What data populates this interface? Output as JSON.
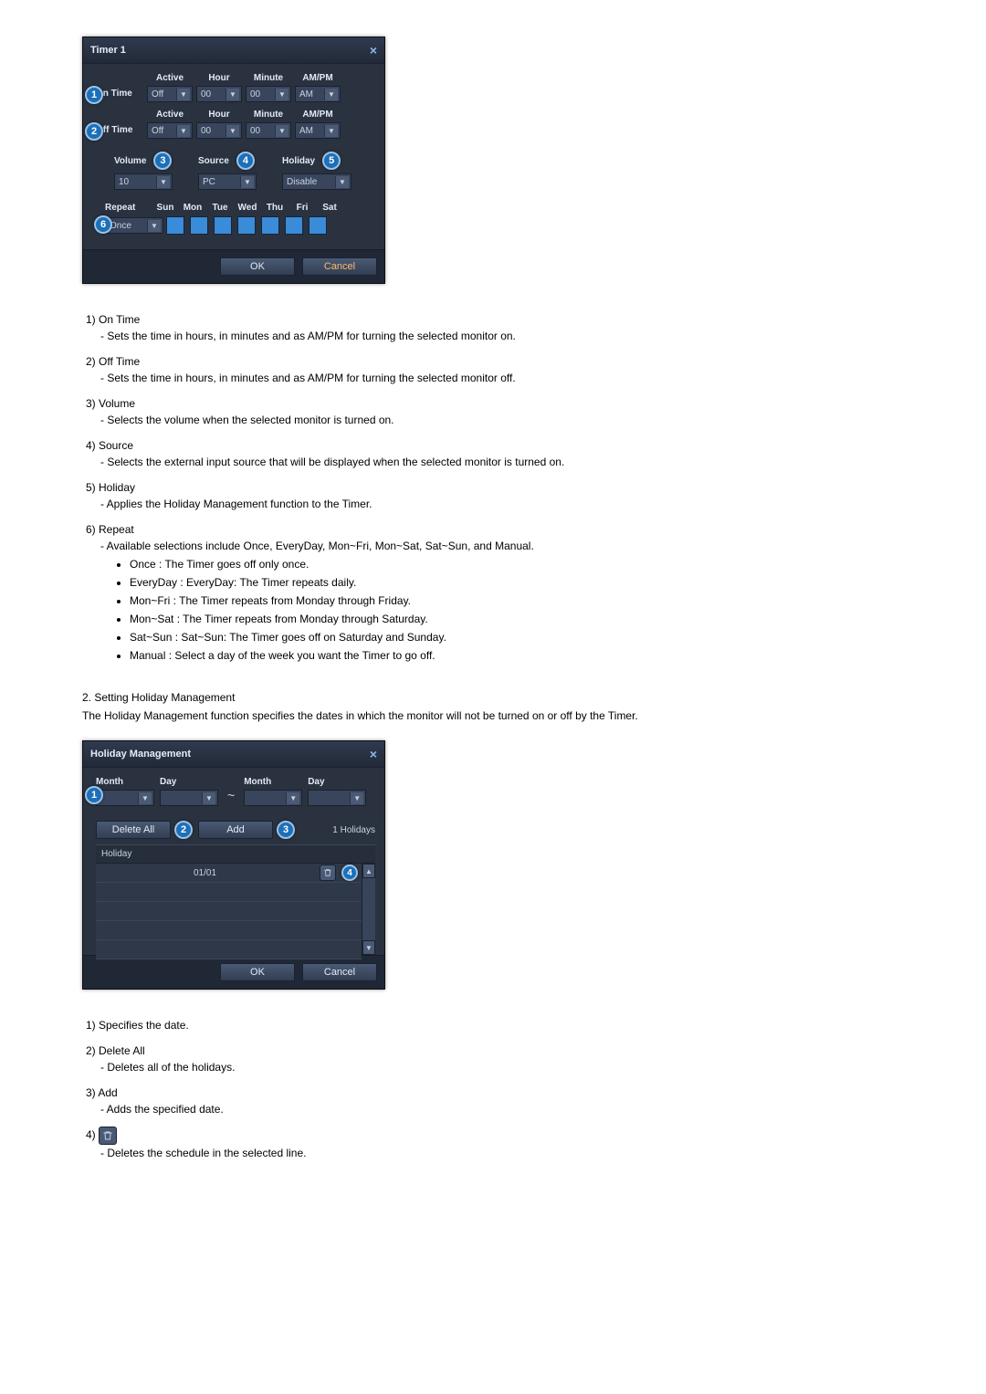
{
  "timer_dialog": {
    "title": "Timer 1",
    "callouts": {
      "c1": "1",
      "c2": "2",
      "c3": "3",
      "c4": "4",
      "c5": "5",
      "c6": "6"
    },
    "on_row": {
      "label": "On Time",
      "active_hdr": "Active",
      "active_val": "Off",
      "hour_hdr": "Hour",
      "hour_val": "00",
      "minute_hdr": "Minute",
      "minute_val": "00",
      "ampm_hdr": "AM/PM",
      "ampm_val": "AM"
    },
    "off_row": {
      "label": "Off Time",
      "active_hdr": "Active",
      "active_val": "Off",
      "hour_hdr": "Hour",
      "hour_val": "00",
      "minute_hdr": "Minute",
      "minute_val": "00",
      "ampm_hdr": "AM/PM",
      "ampm_val": "AM"
    },
    "volume": {
      "label": "Volume",
      "value": "10"
    },
    "source": {
      "label": "Source",
      "value": "PC"
    },
    "holiday": {
      "label": "Holiday",
      "value": "Disable"
    },
    "repeat": {
      "label": "Repeat",
      "value": "Once",
      "days": [
        "Sun",
        "Mon",
        "Tue",
        "Wed",
        "Thu",
        "Fri",
        "Sat"
      ]
    },
    "footer": {
      "ok": "OK",
      "cancel": "Cancel"
    }
  },
  "timer_text": {
    "i1_t": "1) On Time",
    "i1_d": "- Sets the time in hours, in minutes and as AM/PM for turning the selected monitor on.",
    "i2_t": "2) Off Time",
    "i2_d": "- Sets the time in hours, in minutes and as AM/PM for turning the selected monitor off.",
    "i3_t": "3) Volume",
    "i3_d": "- Selects the volume when the selected monitor is turned on.",
    "i4_t": "4) Source",
    "i4_d": "- Selects the external input source that will be displayed when the selected monitor is turned on.",
    "i5_t": "5) Holiday",
    "i5_d": "- Applies the Holiday Management function to the Timer.",
    "i6_t": "6) Repeat",
    "i6_d": "- Available selections include Once, EveryDay, Mon~Fri, Mon~Sat, Sat~Sun, and Manual.",
    "bullets": [
      "Once : The Timer goes off only once.",
      "EveryDay : EveryDay: The Timer repeats daily.",
      "Mon~Fri : The Timer repeats from Monday through Friday.",
      "Mon~Sat : The Timer repeats from Monday through Saturday.",
      "Sat~Sun : Sat~Sun: The Timer goes off on Saturday and Sunday.",
      "Manual : Select a day of the week you want the Timer to go off."
    ]
  },
  "holiday_section": {
    "title": "2. Setting Holiday Management",
    "desc": "The Holiday Management function specifies the dates in which the monitor will not be turned on or off by the Timer."
  },
  "holiday_dialog": {
    "title": "Holiday Management",
    "callouts": {
      "c1": "1",
      "c2": "2",
      "c3": "3",
      "c4": "4"
    },
    "range": {
      "month_hdr": "Month",
      "day_hdr": "Day",
      "sep": "~"
    },
    "delete_all": "Delete All",
    "add": "Add",
    "count": "1 Holidays",
    "table_header": "Holiday",
    "rows": [
      "01/01",
      "",
      "",
      "",
      ""
    ],
    "footer": {
      "ok": "OK",
      "cancel": "Cancel"
    }
  },
  "holiday_text": {
    "i1": "1) Specifies the date.",
    "i2_t": "2) Delete All",
    "i2_d": "- Deletes all of the holidays.",
    "i3_t": "3) Add",
    "i3_d": "- Adds the specified date.",
    "i4_t": "4) ",
    "i4_d": "- Deletes the schedule in the selected line."
  }
}
